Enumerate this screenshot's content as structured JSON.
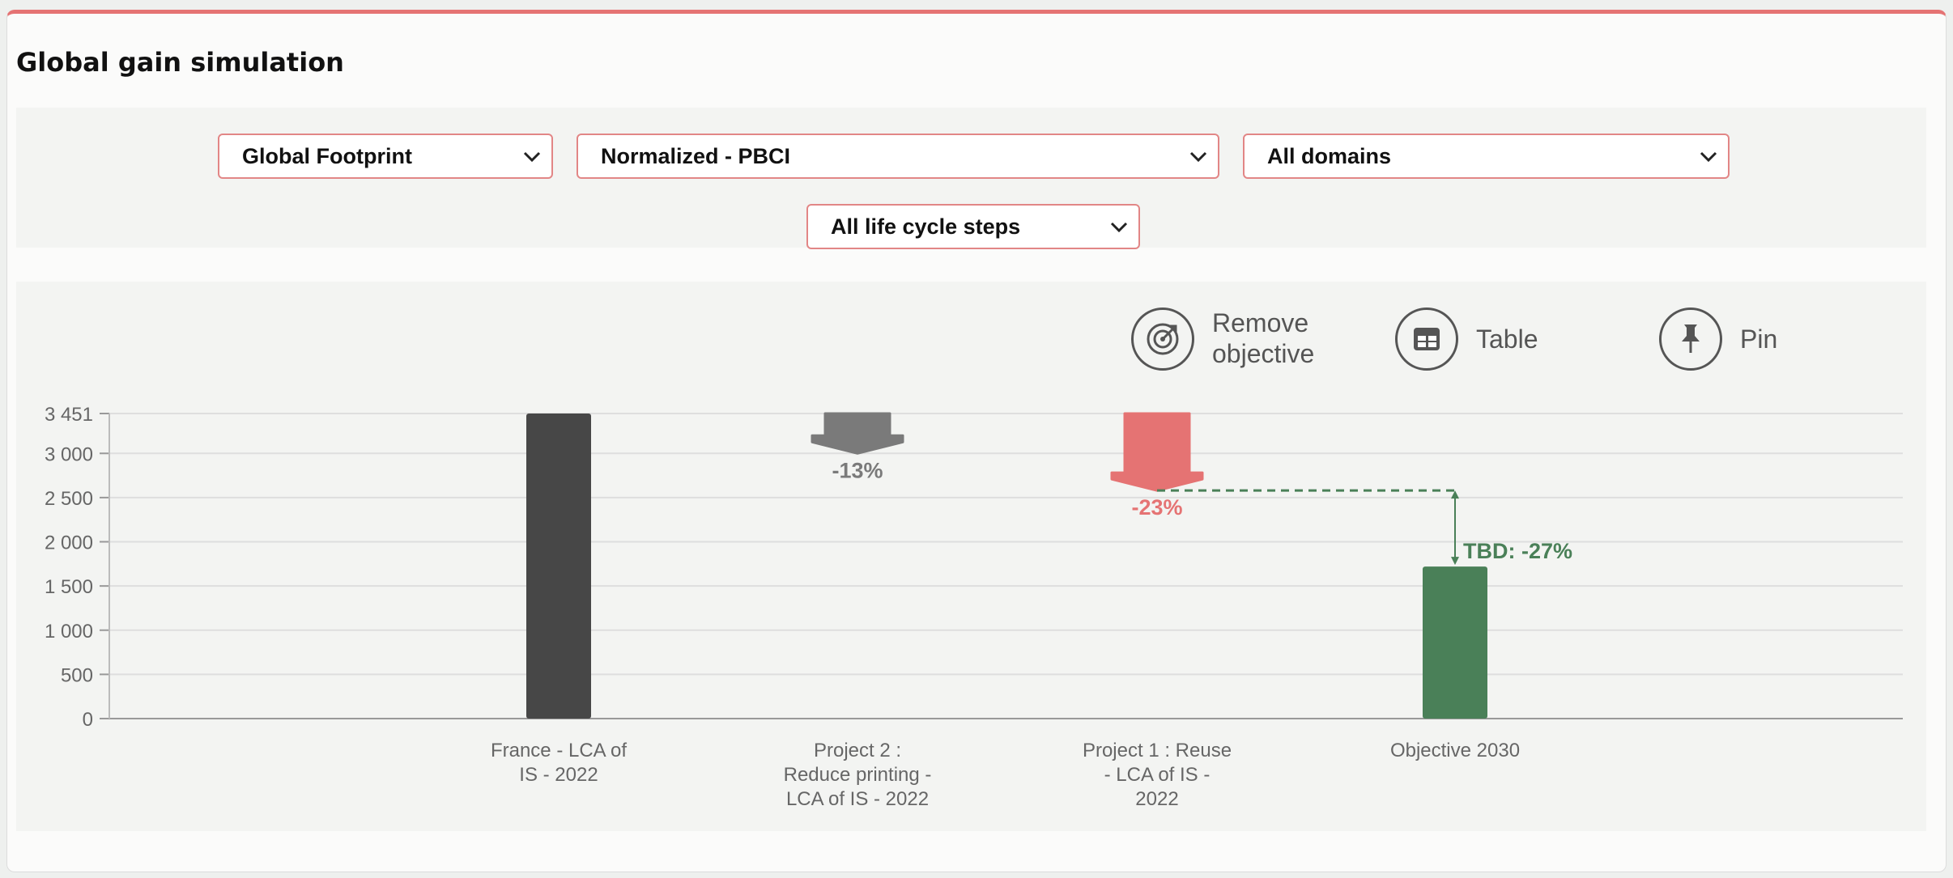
{
  "page": {
    "title": "Global gain simulation"
  },
  "filters": {
    "footprint": "Global Footprint",
    "normalization": "Normalized - PBCI",
    "domains": "All domains",
    "lifecycle": "All life cycle steps"
  },
  "toolbar": {
    "remove_objective": [
      "Remove",
      "objective"
    ],
    "table": "Table",
    "pin": "Pin"
  },
  "colors": {
    "baseline": "#474747",
    "project2": "#7a7a7a",
    "project1": "#e57373",
    "objective": "#4a8058",
    "accent_border": "#e28686"
  },
  "icons": {
    "select_chevron": "chevron-down-icon",
    "remove_objective": "target-icon",
    "table": "table-icon",
    "pin": "pin-icon"
  },
  "chart_data": {
    "type": "bar",
    "yticks": [
      "0",
      "500",
      "1 000",
      "1 500",
      "2 000",
      "2 500",
      "3 000",
      "3 451"
    ],
    "ylim": [
      0,
      3451
    ],
    "grid": true,
    "categories": [
      [
        "France - LCA of",
        "IS - 2022"
      ],
      [
        "Project 2 :",
        "Reduce printing -",
        "LCA of IS - 2022"
      ],
      [
        "Project 1 : Reuse",
        "- LCA of IS -",
        "2022"
      ],
      [
        "Objective 2030"
      ]
    ],
    "baseline": {
      "value": 3451
    },
    "gains": [
      {
        "category_index": 1,
        "label": "-13%",
        "start": 3451,
        "end": 3000,
        "color_key": "project2"
      },
      {
        "category_index": 2,
        "label": "-23%",
        "start": 3451,
        "end": 2580,
        "color_key": "project1"
      }
    ],
    "objective": {
      "value": 1720,
      "gap_label": "TBD: -27%",
      "reference": 2580
    }
  }
}
